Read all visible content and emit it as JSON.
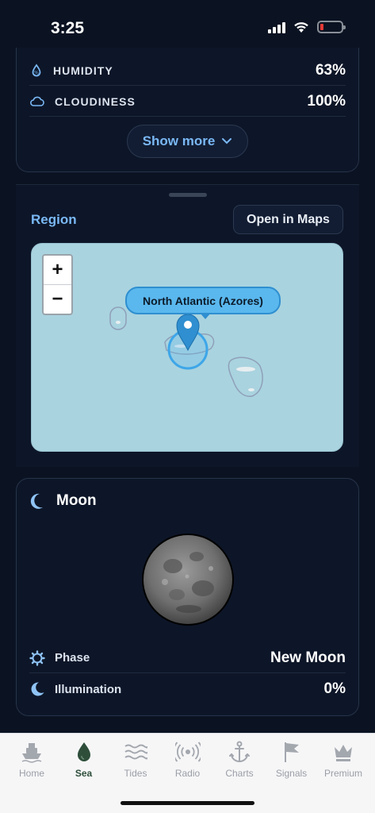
{
  "status_bar": {
    "time": "3:25"
  },
  "weather": {
    "rows": [
      {
        "label": "HUMIDITY",
        "value": "63%",
        "icon": "droplet-icon"
      },
      {
        "label": "CLOUDINESS",
        "value": "100%",
        "icon": "cloud-icon"
      }
    ],
    "show_more_label": "Show more"
  },
  "region": {
    "title": "Region",
    "open_maps_label": "Open in Maps",
    "map": {
      "zoom_in_label": "+",
      "zoom_out_label": "−",
      "location_label": "North Atlantic (Azores)"
    }
  },
  "moon": {
    "title": "Moon",
    "rows": [
      {
        "label": "Phase",
        "value": "New Moon",
        "icon": "sun-gear-icon"
      },
      {
        "label": "Illumination",
        "value": "0%",
        "icon": "crescent-icon"
      }
    ]
  },
  "tab_bar": {
    "tabs": [
      {
        "label": "Home",
        "icon": "ship-icon",
        "active": false
      },
      {
        "label": "Sea",
        "icon": "water-drop-icon",
        "active": true
      },
      {
        "label": "Tides",
        "icon": "waves-icon",
        "active": false
      },
      {
        "label": "Radio",
        "icon": "radio-signal-icon",
        "active": false
      },
      {
        "label": "Charts",
        "icon": "anchor-icon",
        "active": false
      },
      {
        "label": "Signals",
        "icon": "flag-icon",
        "active": false
      },
      {
        "label": "Premium",
        "icon": "crown-icon",
        "active": false
      }
    ]
  },
  "colors": {
    "background": "#0b1322",
    "accent": "#7ab8f5",
    "map_water": "#a9d3df",
    "marker": "#2f8fd0",
    "tab_active": "#2e4e3a",
    "tab_inactive": "#9a9ea6"
  }
}
